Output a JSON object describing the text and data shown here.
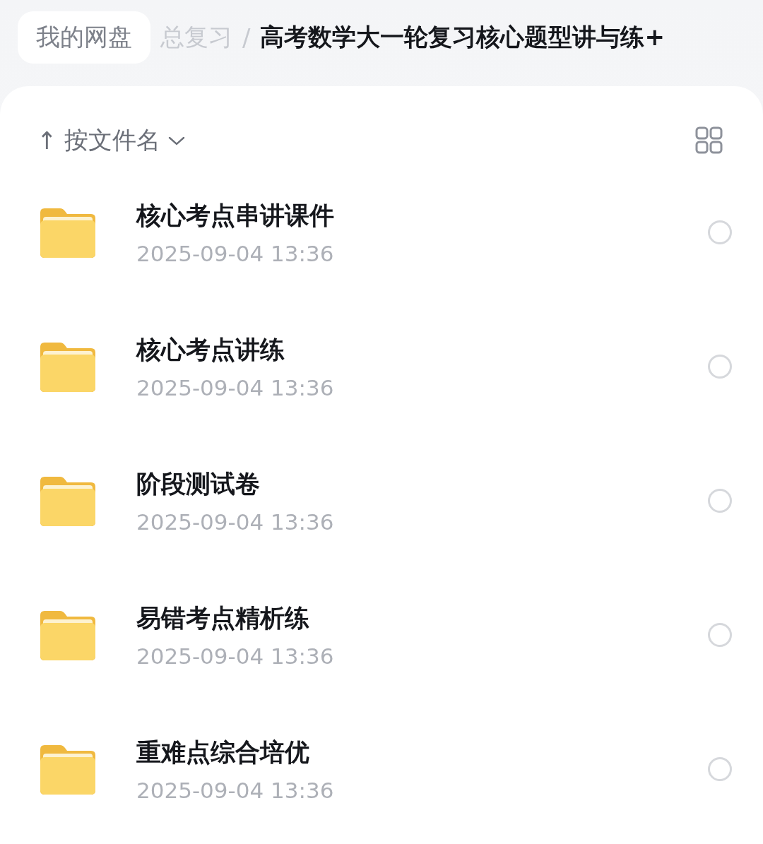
{
  "breadcrumb": {
    "root": "我的网盘",
    "items": [
      {
        "label": "总复习",
        "current": false
      },
      {
        "label": "高考数学大一轮复习核心题型讲与练+",
        "current": true
      }
    ],
    "separator": "/"
  },
  "sort": {
    "arrow": "↑",
    "label": "按文件名"
  },
  "files": [
    {
      "name": "核心考点串讲课件",
      "date": "2025-09-04 13:36",
      "selected": false
    },
    {
      "name": "核心考点讲练",
      "date": "2025-09-04 13:36",
      "selected": false
    },
    {
      "name": "阶段测试卷",
      "date": "2025-09-04 13:36",
      "selected": false
    },
    {
      "name": "易错考点精析练",
      "date": "2025-09-04 13:36",
      "selected": false
    },
    {
      "name": "重难点综合培优",
      "date": "2025-09-04 13:36",
      "selected": false
    }
  ]
}
